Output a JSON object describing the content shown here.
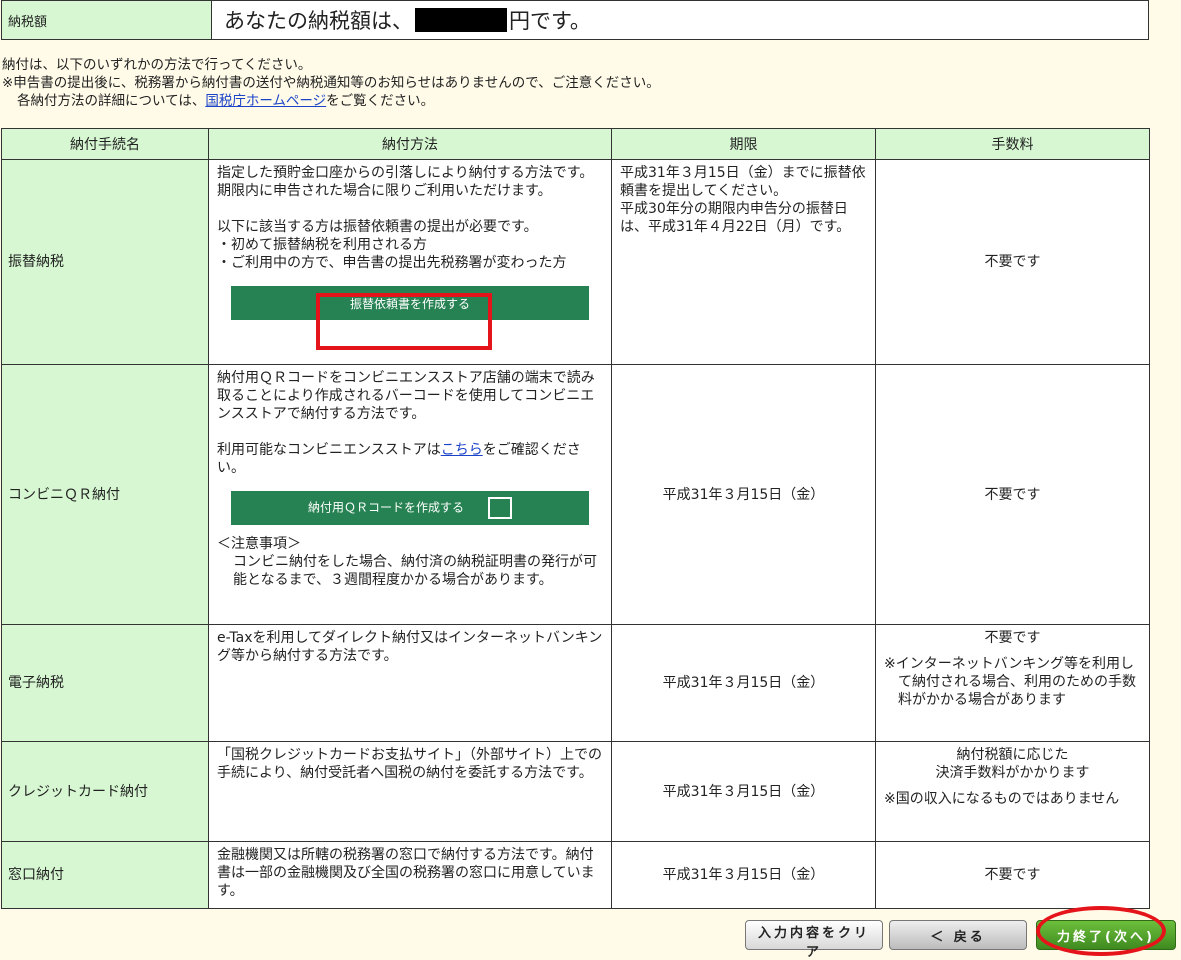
{
  "amount": {
    "label": "納税額",
    "text_before": "あなたの納税額は、",
    "text_after": "円です。"
  },
  "notes": {
    "line1": "納付は、以下のいずれかの方法で行ってください。",
    "line2": "※申告書の提出後に、税務署から納付書の送付や納税通知等のお知らせはありませんので、ご注意ください。",
    "line3_before": "各納付方法の詳細については、",
    "line3_link": "国税庁ホームページ",
    "line3_after": "をご覧ください。"
  },
  "table": {
    "headers": [
      "納付手続名",
      "納付方法",
      "期限",
      "手数料"
    ],
    "furikae": {
      "name": "振替納税",
      "method_lines": [
        "指定した預貯金口座からの引落しにより納付する方法です。",
        "期限内に申告された場合に限りご利用いただけます。",
        "以下に該当する方は振替依頼書の提出が必要です。",
        "・初めて振替納税を利用される方",
        "・ご利用中の方で、申告書の提出先税務署が変わった方"
      ],
      "button": "振替依頼書を作成する",
      "deadline_lines": [
        "平成31年３月15日（金）までに振替依頼書を提出してください。",
        "平成30年分の期限内申告分の振替日は、平成31年４月22日（月）です。"
      ],
      "fee": "不要です"
    },
    "conveni": {
      "name": "コンビニＱＲ納付",
      "method_line1": "納付用ＱＲコードをコンビニエンスストア店舗の端末で読み取ることにより作成されるバーコードを使用してコンビニエンスストアで納付する方法です。",
      "method_line2_before": "利用可能なコンビニエンスストアは",
      "method_line2_link": "こちら",
      "method_line2_after": "をご確認ください。",
      "button": "納付用ＱＲコードを作成する",
      "caution_title": "＜注意事項＞",
      "caution_body": "コンビニ納付をした場合、納付済の納税証明書の発行が可能となるまで、３週間程度かかる場合があります。",
      "deadline": "平成31年３月15日（金）",
      "fee": "不要です"
    },
    "denshi": {
      "name": "電子納税",
      "method": "e-Taxを利用してダイレクト納付又はインターネットバンキング等から納付する方法です。",
      "deadline": "平成31年３月15日（金）",
      "fee": "不要です",
      "fee_note": "※インターネットバンキング等を利用して納付される場合、利用のための手数料がかかる場合があります"
    },
    "credit": {
      "name": "クレジットカード納付",
      "method": "「国税クレジットカードお支払サイト」（外部サイト）上での手続により、納付受託者へ国税の納付を委託する方法です。",
      "deadline": "平成31年３月15日（金）",
      "fee_line1": "納付税額に応じた",
      "fee_line2": "決済手数料がかかります",
      "fee_note": "※国の収入になるものではありません"
    },
    "madoguchi": {
      "name": "窓口納付",
      "method": "金融機関又は所轄の税務署の窓口で納付する方法です。納付書は一部の金融機関及び全国の税務署の窓口に用意しています。",
      "deadline": "平成31年３月15日（金）",
      "fee": "不要です"
    }
  },
  "buttons": {
    "clear": "入力内容をクリア",
    "back": "＜ 戻る",
    "next": "力終了(次へ)"
  },
  "colors": {
    "header_bg": "#d6f7d1",
    "button_green": "#268252",
    "highlight_red": "#e5141b",
    "page_bg": "#fffbe8"
  }
}
